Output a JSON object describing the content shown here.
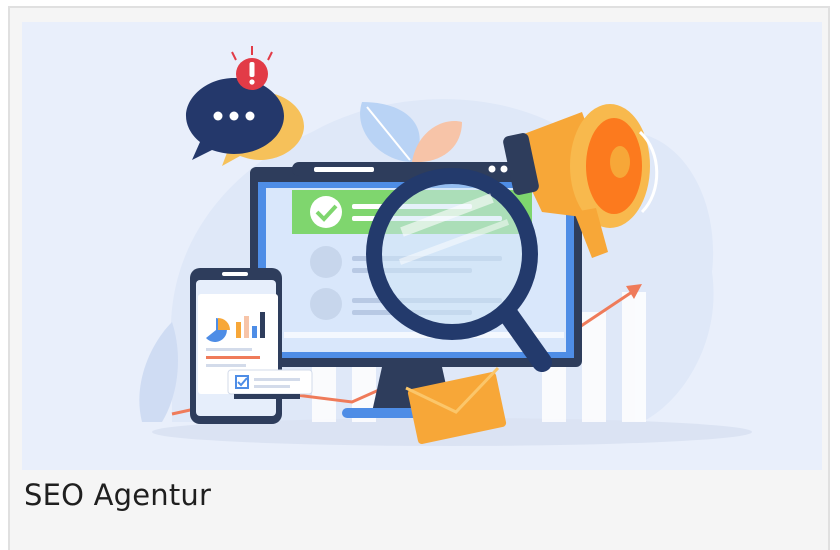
{
  "card": {
    "title": "SEO Agentur",
    "image_subject": "seo-illustration"
  },
  "colors": {
    "background": "#e9effb",
    "monitor_frame": "#2e3d5c",
    "accent_green": "#7fd66e",
    "accent_orange": "#f7a738",
    "accent_blue": "#4e8de6",
    "alert_red": "#e23b47"
  }
}
